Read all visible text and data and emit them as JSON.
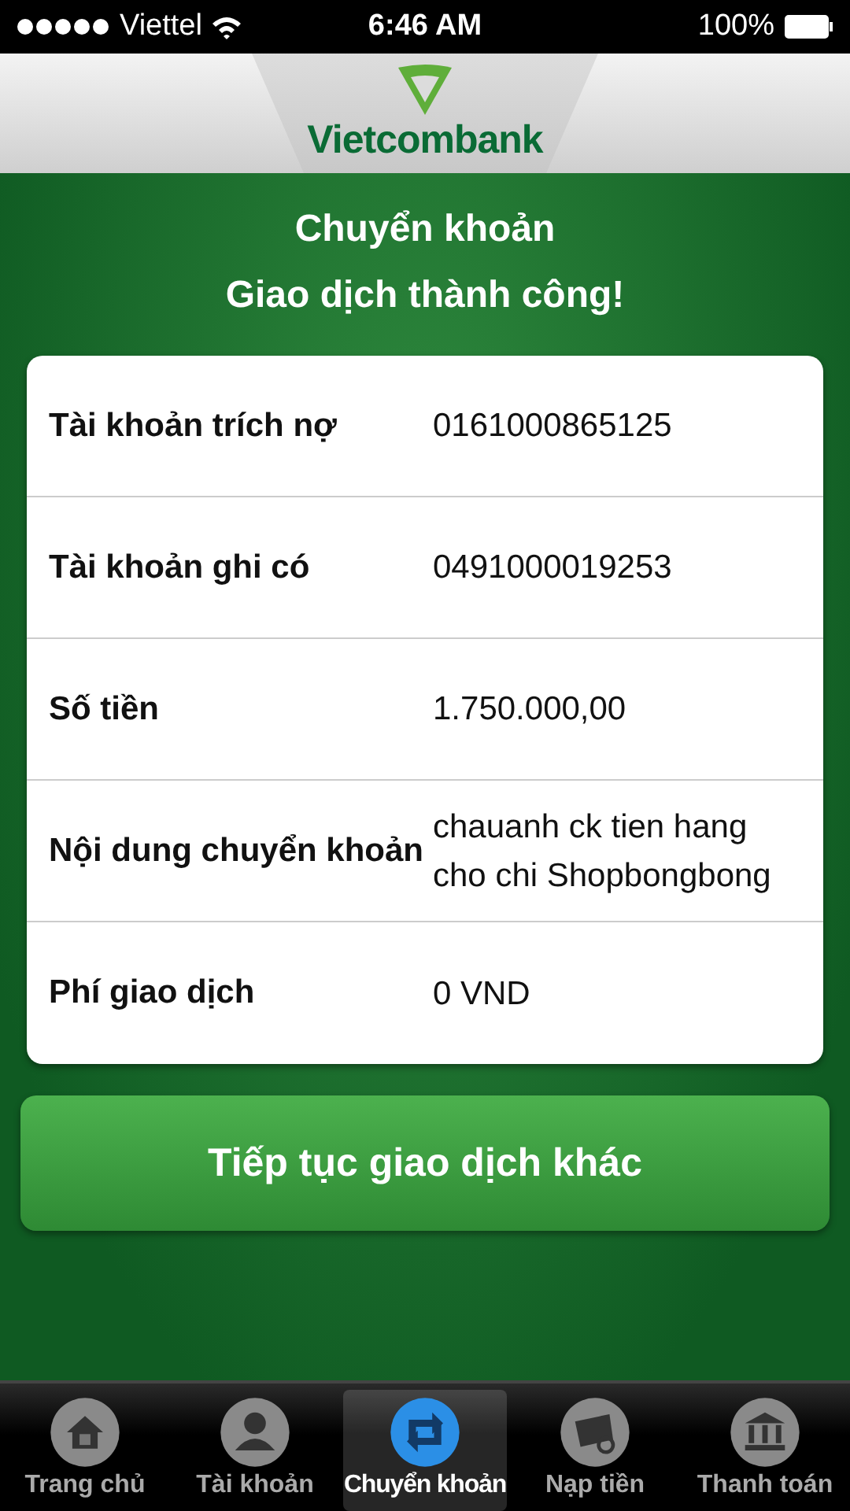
{
  "status_bar": {
    "carrier": "Viettel",
    "time": "6:46 AM",
    "battery": "100%"
  },
  "header": {
    "logo_text": "Vietcombank"
  },
  "title": "Chuyển khoản",
  "subtitle": "Giao dịch thành công!",
  "details": [
    {
      "label": "Tài khoản trích nợ",
      "value": "0161000865125"
    },
    {
      "label": "Tài khoản ghi có",
      "value": "0491000019253"
    },
    {
      "label": "Số tiền",
      "value": "1.750.000,00"
    },
    {
      "label": "Nội dung chuyển khoản",
      "value": "chauanh ck tien hang cho chi Shopbongbong"
    },
    {
      "label": "Phí giao dịch",
      "value": "0 VND"
    }
  ],
  "continue_button": "Tiếp tục giao dịch khác",
  "tabs": [
    {
      "label": "Trang chủ",
      "selected": false
    },
    {
      "label": "Tài khoản",
      "selected": false
    },
    {
      "label": "Chuyển khoản",
      "selected": true
    },
    {
      "label": "Nạp tiền",
      "selected": false
    },
    {
      "label": "Thanh toán",
      "selected": false
    }
  ]
}
